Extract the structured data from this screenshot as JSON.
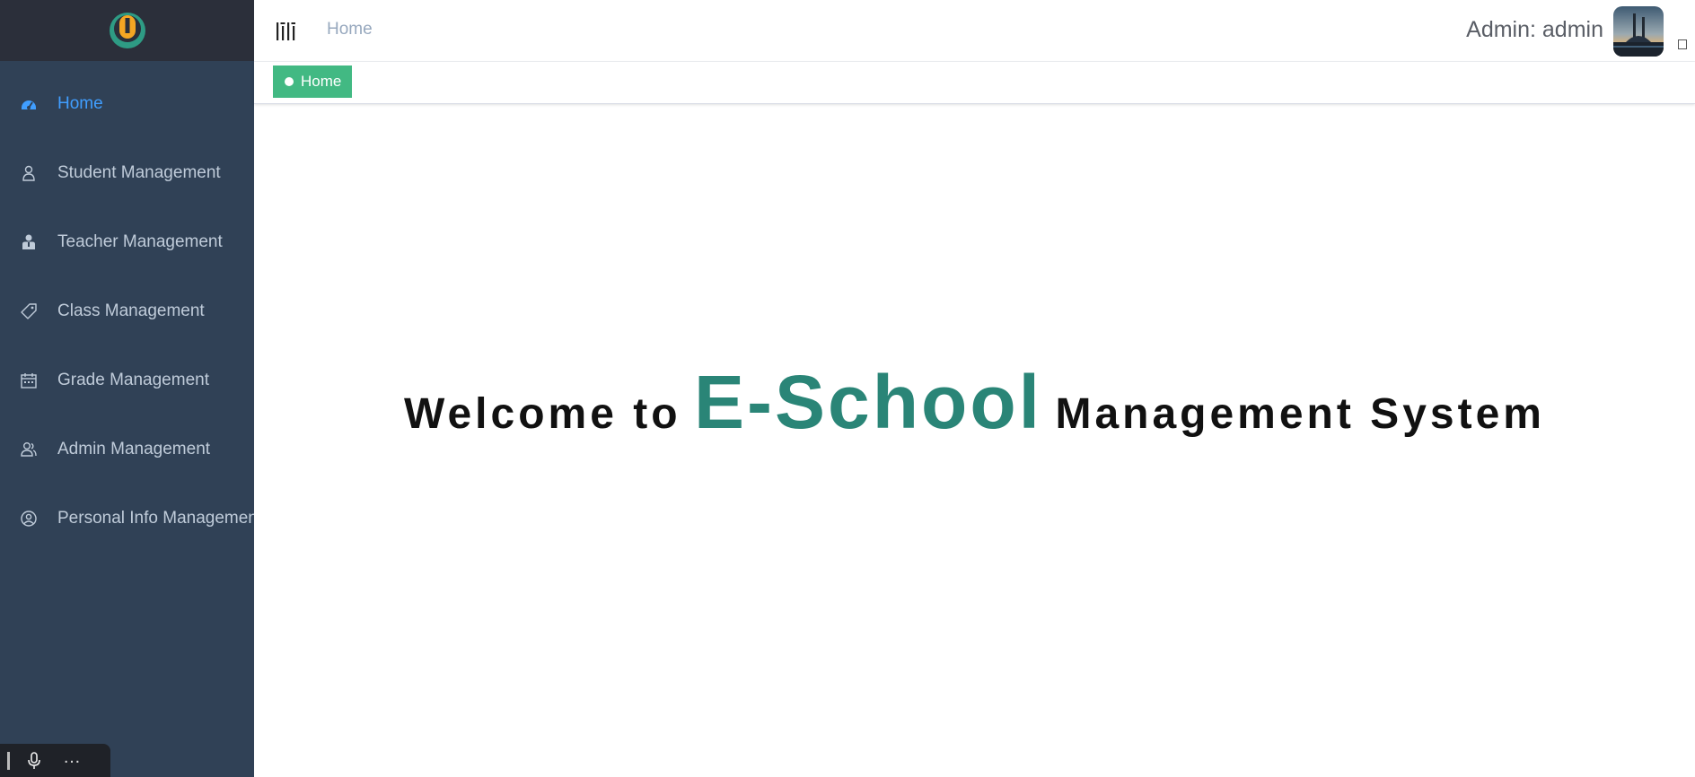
{
  "sidebar": {
    "items": [
      {
        "label": "Home",
        "icon": "dashboard-icon",
        "active": true
      },
      {
        "label": "Student Management",
        "icon": "person-icon"
      },
      {
        "label": "Teacher Management",
        "icon": "teacher-icon"
      },
      {
        "label": "Class Management",
        "icon": "tag-icon"
      },
      {
        "label": "Grade Management",
        "icon": "calendar-icon"
      },
      {
        "label": "Admin Management",
        "icon": "users-icon"
      },
      {
        "label": "Personal Info Management",
        "icon": "user-circle-icon"
      }
    ]
  },
  "header": {
    "breadcrumb": "Home",
    "admin_label": "Admin: admin"
  },
  "tags": {
    "active_tag": "Home"
  },
  "welcome": {
    "prefix": "Welcome to",
    "brand": "E-School",
    "suffix": "Management System"
  },
  "colors": {
    "sidebar_bg": "#304156",
    "logo_bg": "#2b2f3a",
    "active_menu": "#409eff",
    "tag_green": "#42b983",
    "brand_teal": "#2a8577"
  }
}
